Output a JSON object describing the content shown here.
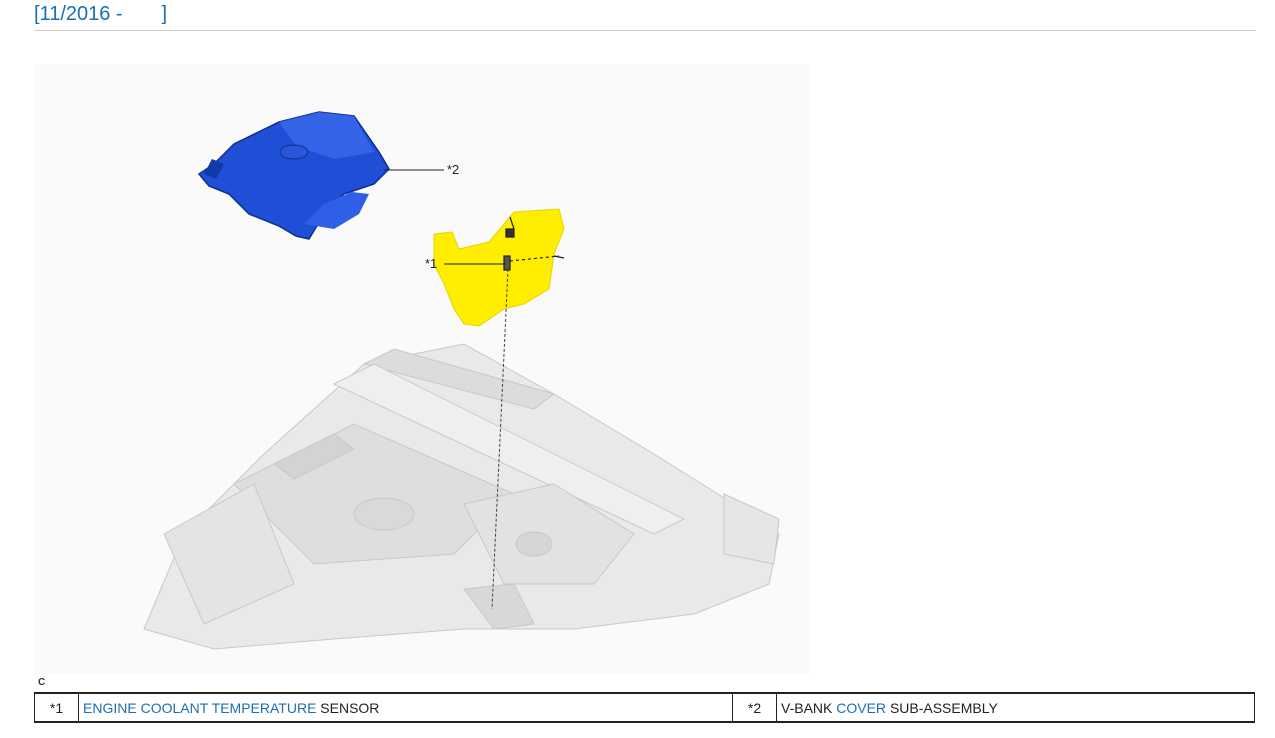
{
  "header": {
    "title_partial_text": "",
    "date_range": "[11/2016 -       ]"
  },
  "illustration": {
    "callouts": [
      "*1",
      "*2"
    ],
    "code": "C"
  },
  "legend": {
    "items": [
      {
        "num": "*1",
        "link1": "ENGINE",
        "link2": "COOLANT",
        "link3": "TEMPERATURE",
        "text": "SENSOR"
      },
      {
        "num": "*2",
        "plain": "V-BANK",
        "link1": "COVER",
        "text": "SUB-ASSEMBLY"
      }
    ]
  },
  "colors": {
    "link": "#1a6fb5",
    "cover_part": "#1f4fd6",
    "highlight": "#ffee00"
  }
}
